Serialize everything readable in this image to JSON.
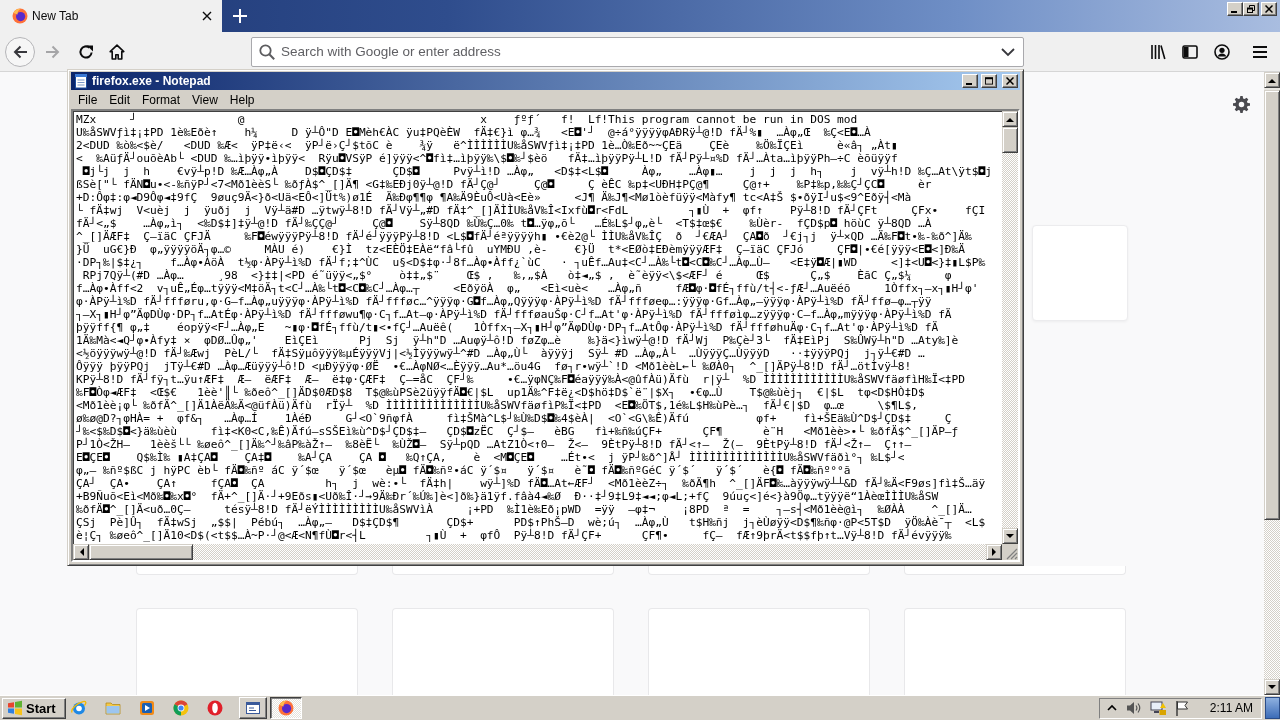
{
  "browser": {
    "tabs": [
      {
        "title": "New Tab",
        "selected": true
      }
    ],
    "navigation": [
      {
        "kind": "back",
        "disabled": false
      },
      {
        "kind": "forward",
        "disabled": true
      },
      {
        "kind": "reload",
        "disabled": false
      },
      {
        "kind": "home",
        "disabled": false
      }
    ],
    "address_bar": {
      "placeholder": "Search with Google or enter address"
    }
  },
  "notepad": {
    "title": "firefox.exe - Notepad",
    "menu": [
      "File",
      "Edit",
      "Format",
      "View",
      "Help"
    ],
    "lines": [
      "MZx     ┘               @                                   x    ƒºƒ´   f!  Lf!This program cannot be run in DOS mod",
      "U‰åSWVƒì‡¡‡PD 1è‰Eðè↑    h¼     D ÿ┴Ô\"D E◘Mèh€ÀC ÿu‡PQèÈW  fÄ‡€}ì φ…¾   <E◘'┘  @÷á°ÿÿÿÿφAÐRÿ┴@!D fÄ┘%▮  …Àφ„Œ  ‰Ç<E◘…À",
      "2<DUD ‰ò‰<$è/   <DUD ‰Æ<  ÿP‡ë‹<  ÿP┘ë›Ç┘$tõC è    ¾ÿ   ë^ÌÌÌÌÌÌU‰åSWVƒì‡¡‡PD 1è…Ò‰Eð~~ÇEä    ÇEè    ‰Ö‰ÏÇEì     è«â┐ „Àt▮",
      "<  ‰AüƒÄ┘ouõèAb└ <DUD ‰…ìþÿÿ•ìþÿÿ<  Rÿu◘VSÿP é]ÿÿÿ<^◘fì‡…ìþÿÿ‰\\$◘‰┘$èö   fÄ‡…ìþÿÿPÿ┴L!D fÄ┘Pÿ┴¤%D fÄ┘…Àta…ìþÿÿPh—÷C èõüÿÿf",
      " ◘j└j  j  h    €vÿ┴p!D ‰Æ…Àφ„À    D$◘ÇD$‡      ÇD$◘     Pvÿ┴ì!D …Àφ„   <D$‡<L$◘     Àφ„    …Àφ▮…    j  j  j  h┐    j  vÿ┴h!D ‰Ç…At\\ÿt$◘j",
      "ßSè[\"└ fÄN◘u•<-‰ñÿP┘<7<Mð1èèS└ ‰ðƒÀ$^_[]Ä¶ <G‡‰EÐj0ÿ┴@!D fÄ┘Ç@┘     Ç@◘     Ç èÊC ‰p‡<UÐH‡PÇ@¶     Ç@↑+    ‰P‡‰p,‰‰Ç┘ÇC◘     èr",
      "+D:Ôφ‡:φ◄D9Ôφ◄‡9fÇ  9øuç9Ä<}ð<Uä<EÔ<]Üt%)ø1É  Ä‰Ðφ¶¶φ ¶A‰Ä9ÈuÔ<Uà<Eè»     <J¶ Ä‰J¶<Mø1òèfüÿÿ<Màfy¶ tc<A‡Š $•ðÿI┘u$<9^Eðÿ┤<Mà",
      "└ fÄ‡wj  V<uèj  j  ÿuðj  j  Vÿ┴ä#D …ÿtwÿ┴8!D fÄ┘Vÿ┴„#D fÄ‡^_[]ÄÌÌU‰åV‰Î<Ixfù◘r<FdL         ┐▮Ù  +  φf↑    Pÿ┴8!D fÄ┘ÇFt     ÇFx•    fÇI",
      "fÄ┘<„$    …Àφ„ì┐  <‰D$‡]‡ÿ┴@!D fÄ┘‰ÇÇ@┘     Ç@◘    Sÿ┴8QD ‰Ù‰Ç…0‰ t◘…ÿφ„õ└   …É‰L$┘φ„è└  <T$‡œ$€    ‰Ùèr-  fÇD$p◘ höùC ÿ┴8QD …À",
      "^_[]ÄÆF‡  Ç–ïäC ÇFJÄ     ‰F◘éwÿÿÿPÿ┴8!D fÄ┘é┘ÿÿÿPÿ┴8!D <L$◘fÄ┘éªÿÿÿÿh▮ •€è2@└ ÌÌU‰åV‰ÎÇ  ð  ┘€ÆA┘  ÇA◘ð  ┘€j┐j  ÿ┴×QD …Ä‰F◘t•‰-‰ð^]Ä‰",
      "}Ü  uG€}Ð  φ„ÿÿÿÿöÄ┐φ…©     MÀU é)    €}Ì  tz<EÈÖ‡EÀë“fâ└fû  uYMÐU ,è-    €}Ü  t*<EØò‡EÐèmÿÿÿÆF‡  Ç–ïäC ÇFJó     ÇF◘|•€é[ÿÿÿ<E◘<]Ð‰Ä",
      "·DP┐‰|$‡¿┐    f…Àφ•ÀöÀ  t½φ·ÀPÿ┴ì%D fÄ┘f;‡^ÙC  u§<D$‡φ·┘8f…Àφ•Àff¿`ùC   · ┐uÊf…Au‡<C┘…À‰└t◘<C◘‰C┘…Àφ…Ù–   <E‡ÿ◘Æ|▮WD     <]‡<U◘<}‡▮L$P‰",
      " RPj7Qÿ┴(#D …Àφ…     ¸98  <}‡‡|<PD é˜üÿÿ<„$°    ò‡‡„$¨    Œ$ ,   ‰,„$À   ò‡◄„$ ,  è˜èÿÿ<\\$<ÆF┘ é     Œ$      Ç„$    ÈãC Ç„$¼     φ",
      "f…Àφ•Àff<2  v┐uÊ„Éφ…tÿÿÿ<M‡öÄ┐t<C┘…À‰└t◘<C◘‰C┘…Àφ…┬     <EðÿöÀ  φ„   <Eì<uè<   …Àφ„ñ     fÆ◘φ·◘fÉ┐ffù/t┤<-ƒÆ┘…Auëéõ     1Òffx┐–x┐▮H┘φ'",
      "φ·ÀPÿ┴ì%D fÄ┘ffføru,φ·G–f…Àφ„uÿÿÿφ·ÀPÿ┴ì%D fÄ┘ffføc…^ÿÿÿφ·G◘f…Àφ„Qÿÿÿφ·ÀPÿ┴ì%D fÄ┘ffføeφ…:ÿÿÿφ·Gf…Àφ„–ÿÿÿφ·ÀPÿ┴ì%D fÄ┘ffø–φ…┬ÿÿ",
      "┐–X┐▮H┘φ”ÄφDÙφ·DP┐f…AtÉφ·ÀPÿ┴ì%D fÄ┘ffføwu¶φ·C┐f…At–φ·ÀPÿ┴ì%D fÄ┘ffføauŠφ·C┘f…At'φ·ÀPÿ┴ì%D fÄ┘ffføìφ…zÿÿÿφ·C–f…Àφ„mÿÿÿφ·ÀPÿ┴ì%D fÄ",
      "þÿÿff{¶ φ„‡    éopÿÿ<F┘…Àφ„E   ~▮φ·◘fÉ┐ffù/t▮<•fÇ┘…Auëê(   1Òffx┐–X┐▮H┘φ”ÄφDÙφ·DP┐f…AtÔφ·ÀPÿ┴ì%D fÄ┘ffføhuÄφ·C┐f…At'φ·ÀPÿ┴ì%D fÄ",
      "1Ä‰Mà<◄Q┘φ•Àfy‡ ×  φDØ…Ûφ„'    EìÇEì      Pj  Sj  ÿ┴h\"D …Auφÿ┴ô!D føZφ…è    ‰}ä<}ìwÿ┴@!D fÄ┘Wj  P‰Çè┘3└  fÄ‡EìPj  S‰ÛWÿ┴h\"D …Aty‰]è",
      "<½öÿÿÿwÿ┴@!D fÄ┘‰Æwj  PèL/└  fÄ‡Sÿµôÿÿÿ‰µÉÿÿÿVj|<½Ìÿÿÿwÿ┴^#D …Àφ„Ù└  àÿÿÿj  Sÿ┴ #D …Àφ„À└  …ÙÿÿÿÇ…ÙÿÿÿD   ··‡ÿÿÿPQj  j┐ÿ┴€#D …",
      "Ôÿÿÿ þÿÿPQj  jTÿ┴€#D …Àφ…Æüÿÿÿ┴ô!D <µÐÿÿÿφ·ØË  •€…ÀφNØ<…Èÿÿÿ…Au*…öu4G  fø┐r•wÿ┴`!D <Mð1èèL←└ ‰ØÀ0┐  ^_[]ÄPÿ┴8!D fÄ┘…ötÌvÿ┴8!",
      "KPÿ┴8!D fÄ┘fÿ┐t…ÿu↑ÆF‡  Æ–  ëÆF‡  Æ–  ë‡φ·ÇÆF‡  Ç–=åC  ÇF┘‰     •€…ÿφNÇ‰F◘éaÿÿÿ‰À<@ûfÀü)Äfù  r|ÿ┴  %D ÌÌÌÌÌÌÌÌÌÌÌÌU‰åSWVfäøfìH‰Ï<‡PD",
      "‰F◘Òφ◄ÆF‡  <Œ$€   1èè'║└ ‰ðeô^_[]ÄD$0ÆD$8  T$@‰ùPSè2üÿÿfÄ◘€|$L  up1Ä‰^F‡ë¿<D$hö‡D$`ë¨|$X┐  •€φ…Ù    T$@‰ùèj┐  €|$L  tφ<D$HÒ‡D$",
      "<Mð1èè¡φ└ ‰ðfÄ^_[]Ä1ÀëÄ‰Ä<@üfÀü)Äfù  rÏÿ┴  %D ÌÌÌÌÌÌÌÌÌÌÌÌÌÌU‰åSWVfäøfìP‰Ï<‡PD  <E◘‰ÖT$,1é‰L$H‰ùPè…┐  fÄ┘€|$D  φ…œ     \\$¶L$,",
      "ø‰ø@D?┐φHÀ= +  φf&┐   …Àφ…Í    1ÀéÐ     G┘<O`9ñφfÀ     fì‡ŠMà^L$┘‰Ù‰D$◘‰4$èÀ|  <O`<G\\‰Ê)Äfú          φf+    fì+ŠEä‰Ù^D$┘ÇD$‡     Ç",
      "┘‰<$‰D$◘<}ä‰ùèù     fì‡<K0<C,‰Ê)Äfú–sSŠEì‰ù^D$┘ÇD$‡–   ÇD$◘zËC  Ç┘$–   èBG   fì+‰ñ‰úÇF+      ÇF¶      è¨H   <Mð1èè>•└ ‰ðfÄ$^_[]ÄP–ƒ",
      "P┘1Ò<ŽH–   1èèš└└ ‰øeô^_[]Ä‰^┘‰âP‰àŽ↑–  ‰8èË└  ‰ÙŽ◘–  Sÿ┴pQD …AtZ1Ò<↑0–  Ž<–  9ÈtPÿ┴8!D fÄ┘<↑–  Ž(–  9ÈtPÿ┴8!D fÄ┘<Ž↑–  Ç↑↑–",
      "E◘ÇE◘    Q$‰Ì‰ ▮A‡ÇA◘    ÇA‡◘    ‰A┘ÇA    ÇA ◘   ‰Q↑ÇA,    è  <M◘ÇE◘    …Ét•<  j ÿP┘‰ð^]Å┘ ÌÌÌÌÌÌÌÌÌÌÌÌÌÌU‰åSWVfäðì°┐ ‰L$┘<",
      "φ„– ‰ñº$ßC j hÿPC èb└ fÄ◘‰ñº áC ÿ´$œ   ÿ´$œ   èµ◘ fÄ◘‰ñº•áC ÿ´$¤   ÿ´$¤   è˜◘ fÄ◘‰ñºGéC ÿ´$´   ÿ´$´   è{◘ fÄ◘‰ñº°°ã",
      "ÇA┘  ÇA•    ÇA↑     fÇA◘  ÇA         h┐  j  wè:•└  fÄ‡h|    wÿ┴]%D fÄ◘…At←ÆF┘  <Mð1èèZ÷┐  ‰ðÄ¶h  ^_[]ÄF◘‰…àÿÿÿwÿ┴┴&D fÄ┘‰Ä<F9øs]fì‡Š…äÿ",
      "+B9Ñuõ<Eì<Mð‰◘‰x◘°  fÄ+^_[]Ä·┘+9Eðs▮<Uð‰Î·┘→9Ä‰Ðr´‰Ú‰]è<]ð‰}ä1ÿf.fâà4◄‰Ø  Ð··‡┘9‡L9‡◄◄;φ◄L;+fÇ  9úuç<]é<}à9Öφ…tÿÿÿë“1ÀèœÌÌÌU‰åSW",
      "‰ðfÄ◘^_[]Ä<uð…0Ç–     tésÿ┴8!D fÄ┘ëÝÌÌÌÌÌÌÌÌÌU‰åSWVìÀ     ¡+PD  ‰Ì1è‰Eð¡pWD  =ÿÿ  –φ‡¬    ¡8PD  ª  =    ┐–s┤<Mð1èè@ì┐  ‰ØÀÀ    ^_[]Ä…",
      "ÇSj  Pè]Û┐  fÄ‡wSj  „$$|  Pébú┐  …Àφ„–   D$‡ÇD$¶       ÇD$+      PD$↑PhŠ–D  wè;ú┐  …Àφ„Ù   t$H‰ñj  j┐èÙøÿÿ<D$¶‰ñφ·@P<5T$D  ÿÖ‰Àè¯┬  <L$",
      "è¦Ç┐ ‰øeô^_[]Ä10<D$(<t$$…À~P·┘@<Æ<N¶fÙ◘r<┤L         ┐▮Ù  +  φfÔ  Pÿ┴8!D fÄ┘ÇF+      ÇF¶•     fÇ–  fÆ↑9þrÄ<t$$fþ↑t…Vÿ┴8!D fÄ┘évÿÿÿ‰"
    ]
  },
  "taskbar": {
    "start": "Start",
    "quick_launch": [
      {
        "kind": "ie"
      },
      {
        "kind": "folder"
      },
      {
        "kind": "media"
      },
      {
        "kind": "chrome"
      },
      {
        "kind": "opera"
      }
    ],
    "windows": [
      {
        "kind": "app",
        "selected": false
      },
      {
        "kind": "firefox",
        "selected": true
      }
    ],
    "clock": "2:11 AM"
  }
}
